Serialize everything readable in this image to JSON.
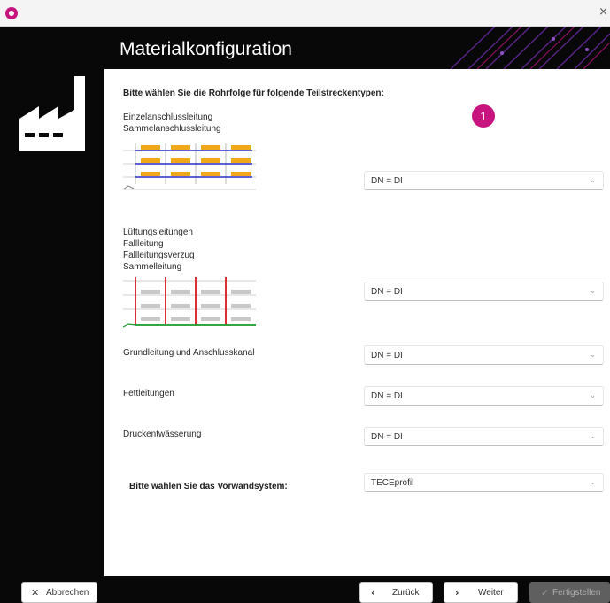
{
  "window": {
    "close_glyph": "×"
  },
  "header": {
    "title": "Materialkonfiguration"
  },
  "panel": {
    "heading": "Bitte wählen Sie die Rohrfolge für folgende Teilstreckentypen:",
    "badge": "1",
    "sections": [
      {
        "lines": [
          "Einzelanschlussleitung",
          "Sammelanschlussleitung"
        ],
        "dropdown_value": "DN = DI"
      },
      {
        "lines": [
          "Lüftungsleitungen",
          "Fallleitung",
          "Fallleitungsverzug",
          "Sammelleitung"
        ],
        "dropdown_value": "DN = DI"
      },
      {
        "lines": [
          "Grundleitung und Anschlusskanal"
        ],
        "dropdown_value": "DN = DI"
      },
      {
        "lines": [
          "Fettleitungen"
        ],
        "dropdown_value": "DN = DI"
      },
      {
        "lines": [
          "Druckentwässerung"
        ],
        "dropdown_value": "DN = DI"
      }
    ],
    "vorwand": {
      "label": "Bitte wählen Sie das Vorwandsystem:",
      "value": "TECEprofil"
    }
  },
  "footer": {
    "cancel_label": "Abbrechen",
    "back_label": "Zurück",
    "next_label": "Weiter",
    "finish_label": "Fertigstellen"
  },
  "colors": {
    "accent": "#c8147e",
    "frame": "#080808",
    "disabled_button": "#5f5f5f"
  },
  "icons": {
    "app": "app-logo-icon",
    "close": "close-icon",
    "factory": "factory-icon",
    "dropdown": "chevron-down-icon",
    "cancel": "x-icon",
    "back": "chevron-left-icon",
    "next": "chevron-right-icon",
    "finish": "check-icon"
  }
}
